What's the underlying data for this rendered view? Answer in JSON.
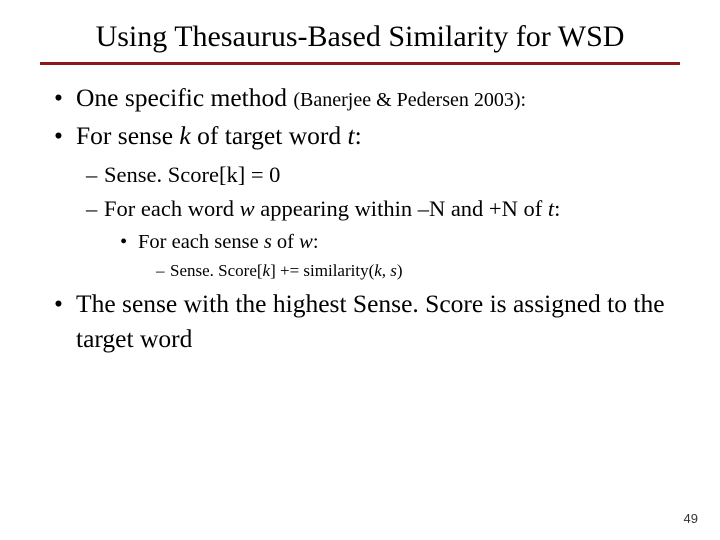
{
  "title": "Using Thesaurus-Based Similarity for WSD",
  "bullets": {
    "b1_pre": "One specific method ",
    "b1_cite": "(Banerjee & Pedersen 2003):",
    "b2_a": "For sense ",
    "b2_k": "k",
    "b2_b": " of target word ",
    "b2_t": "t",
    "b2_c": ":",
    "s1": "Sense. Score[k] = 0",
    "s2_a": "For each word ",
    "s2_w": "w",
    "s2_b": " appearing within –N and +N of ",
    "s2_t": "t",
    "s2_c": ":",
    "s3_a": "For each sense ",
    "s3_s": "s",
    "s3_b": " of ",
    "s3_w": "w",
    "s3_c": ":",
    "s4_a": "Sense. Score[",
    "s4_k": "k",
    "s4_b": "] += similarity(",
    "s4_ks": "k, s",
    "s4_c": ")",
    "b3": "The sense with the highest Sense. Score is assigned to the target word"
  },
  "page": "49"
}
